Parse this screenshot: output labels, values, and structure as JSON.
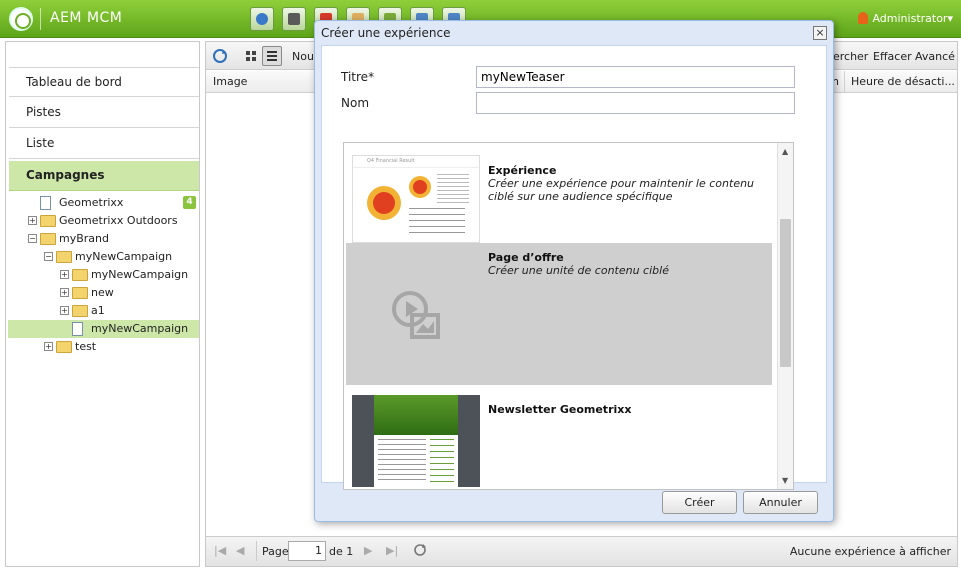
{
  "app": {
    "brand": "AEM MCM",
    "user": "Administrator"
  },
  "toolbar_icons": [
    {
      "name": "globe-icon",
      "color": "#3a79c8"
    },
    {
      "name": "camera-icon",
      "color": "#5a5a5a"
    },
    {
      "name": "campaign-icon",
      "color": "#d83a2a"
    },
    {
      "name": "mail-icon",
      "color": "#e0b060"
    },
    {
      "name": "users-icon",
      "color": "#7bab3a"
    },
    {
      "name": "tools-icon",
      "color": "#4f86c6"
    },
    {
      "name": "tag-icon",
      "color": "#4f86c6"
    }
  ],
  "sidebar": {
    "items": [
      {
        "label": "Tableau de bord"
      },
      {
        "label": "Pistes"
      },
      {
        "label": "Liste"
      },
      {
        "label": "Campagnes"
      }
    ],
    "tree": [
      {
        "label": "Geometrixx",
        "badge": "4"
      },
      {
        "label": "Geometrixx Outdoors"
      },
      {
        "label": "myBrand"
      },
      {
        "label": "myNewCampaign"
      },
      {
        "label": "myNewCampaign"
      },
      {
        "label": "new"
      },
      {
        "label": "a1"
      },
      {
        "label": "myNewCampaign"
      },
      {
        "label": "test"
      }
    ]
  },
  "grid": {
    "toolbar_partial": "Nouv",
    "search_partial": "hercher",
    "clear": "Effacer",
    "advanced": "Avancé",
    "columns": [
      "Image",
      "n",
      "Heure de désacti..."
    ],
    "pager": {
      "page_label": "Page",
      "page_value": "1",
      "of_label": "de 1"
    },
    "status": "Aucune expérience à afficher"
  },
  "dialog": {
    "title": "Créer une expérience",
    "title_label": "Titre",
    "required_mark": "*",
    "title_value": "myNewTeaser",
    "name_label": "Nom",
    "name_value": "",
    "templates": [
      {
        "title": "Expérience",
        "desc": "Créer une expérience pour maintenir le contenu ciblé sur une audience spécifique"
      },
      {
        "title": "Page d’offre",
        "desc": "Créer une unité de contenu ciblé"
      },
      {
        "title": "Newsletter Geometrixx",
        "desc": ""
      }
    ],
    "thumb_text": "Q4 Financial Result",
    "create_label": "Créer",
    "cancel_label": "Annuler"
  }
}
